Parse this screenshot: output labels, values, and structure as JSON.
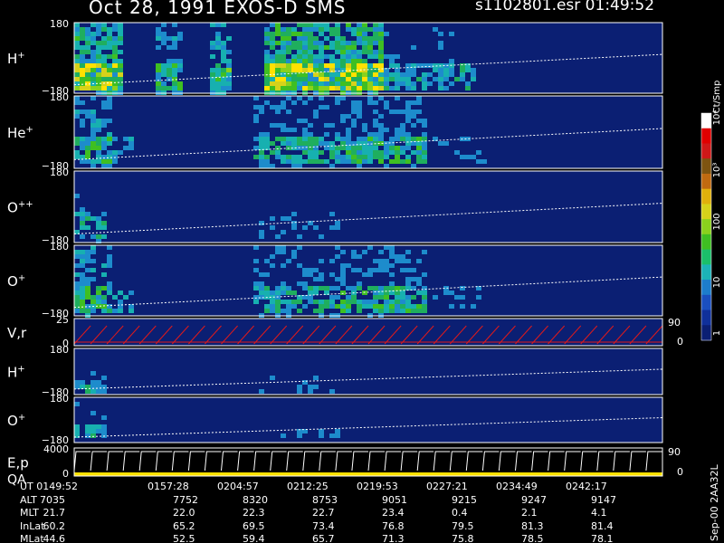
{
  "header": {
    "title": "Oct 28, 1991    EXOS-D SMS",
    "file_time": "s1102801.esr   01:49:52"
  },
  "colorbar": {
    "unit_label": "Ct/Smp",
    "ticks": [
      "1",
      "10",
      "100",
      "10³",
      "10⁴"
    ]
  },
  "footer": {
    "version_label": "Sep-00  2AA32L",
    "row_labels": [
      "UT",
      "ALT",
      "MLT",
      "InLat",
      "MLat"
    ]
  },
  "chart_data": {
    "type": "heatmap",
    "title": "Oct 28, 1991    EXOS-D SMS",
    "x_axis": {
      "label": "UT",
      "ticks": [
        "0149:52",
        "0157:28",
        "0204:57",
        "0212:25",
        "0219:53",
        "0227:21",
        "0234:49",
        "0242:17"
      ]
    },
    "ephemeris": [
      {
        "label": "ALT",
        "values": [
          "7035",
          "7752",
          "8320",
          "8753",
          "9051",
          "9215",
          "9247",
          "9147"
        ]
      },
      {
        "label": "MLT",
        "values": [
          "21.7",
          "22.0",
          "22.3",
          "22.7",
          "23.4",
          "0.4",
          "2.1",
          "4.1"
        ]
      },
      {
        "label": "InLat",
        "values": [
          "60.2",
          "65.2",
          "69.5",
          "73.4",
          "76.8",
          "79.5",
          "81.3",
          "81.4"
        ]
      },
      {
        "label": "MLat",
        "values": [
          "44.6",
          "52.5",
          "59.4",
          "65.7",
          "71.3",
          "75.8",
          "78.5",
          "78.1"
        ]
      }
    ],
    "panels": [
      {
        "id": "H+",
        "label": "H",
        "charge": "+",
        "ylim": [
          -180,
          180
        ],
        "y_ticks": [
          "180",
          "−180"
        ],
        "activity": "high"
      },
      {
        "id": "He+",
        "label": "He",
        "charge": "+",
        "ylim": [
          -180,
          180
        ],
        "y_ticks": [
          "180",
          "−180"
        ],
        "activity": "medium"
      },
      {
        "id": "O++",
        "label": "O",
        "charge": "++",
        "ylim": [
          -180,
          180
        ],
        "y_ticks": [
          "180",
          "−180"
        ],
        "activity": "low"
      },
      {
        "id": "O+",
        "label": "O",
        "charge": "+",
        "ylim": [
          -180,
          180
        ],
        "y_ticks": [
          "180",
          "−180"
        ],
        "activity": "medium"
      },
      {
        "id": "Vr",
        "label": "V,r",
        "charge": "",
        "ylim": [
          0,
          25
        ],
        "y_ticks": [
          "25",
          "0"
        ],
        "right_ticks": [
          "90",
          "0"
        ],
        "kind": "line"
      },
      {
        "id": "H+2",
        "label": "H",
        "charge": "+",
        "ylim": [
          -180,
          180
        ],
        "y_ticks": [
          "180",
          "−180"
        ],
        "activity": "low"
      },
      {
        "id": "O+2",
        "label": "O",
        "charge": "+",
        "ylim": [
          -180,
          180
        ],
        "y_ticks": [
          "180",
          "−180"
        ],
        "activity": "low"
      },
      {
        "id": "EpQA",
        "label": "E,p",
        "label2": "QA",
        "ylim": [
          0,
          4000
        ],
        "y_ticks": [
          "4000",
          "0"
        ],
        "right_ticks": [
          "90",
          "0"
        ],
        "kind": "sweep"
      }
    ],
    "colorbar": {
      "scale": "log",
      "range": [
        1,
        10000
      ],
      "unit": "Ct/Smp",
      "ticks": [
        "1",
        "10",
        "100",
        "10³",
        "10⁴"
      ]
    }
  }
}
